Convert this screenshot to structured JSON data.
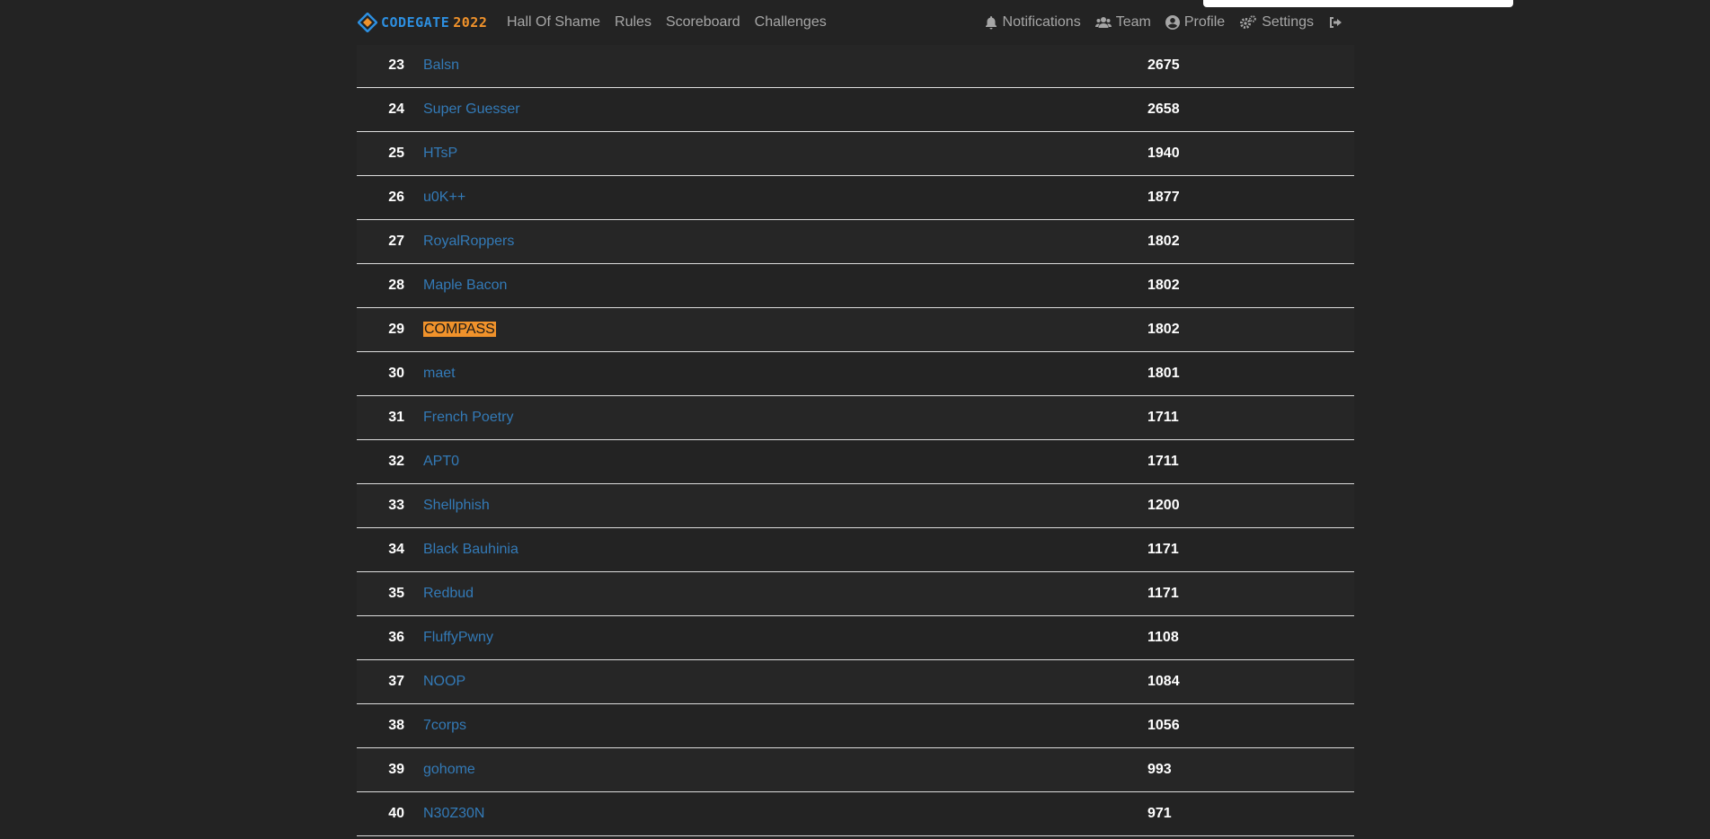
{
  "brand": {
    "part1": "CODEGATE",
    "part2": "2022"
  },
  "nav": {
    "left": [
      "Hall Of Shame",
      "Rules",
      "Scoreboard",
      "Challenges"
    ],
    "notifications": "Notifications",
    "team": "Team",
    "profile": "Profile",
    "settings": "Settings"
  },
  "colors": {
    "background": "#232323",
    "link": "#337ab7",
    "highlight": "#f0922b",
    "brand_blue": "#2d8fe0"
  },
  "rows": [
    {
      "rank": "23",
      "team": "Balsn",
      "score": "2675"
    },
    {
      "rank": "24",
      "team": "Super Guesser",
      "score": "2658"
    },
    {
      "rank": "25",
      "team": "HTsP",
      "score": "1940"
    },
    {
      "rank": "26",
      "team": "u0K++",
      "score": "1877"
    },
    {
      "rank": "27",
      "team": "RoyalRoppers",
      "score": "1802"
    },
    {
      "rank": "28",
      "team": "Maple Bacon",
      "score": "1802"
    },
    {
      "rank": "29",
      "team": "COMPASS",
      "score": "1802",
      "highlight": true
    },
    {
      "rank": "30",
      "team": "maet",
      "score": "1801"
    },
    {
      "rank": "31",
      "team": "French Poetry",
      "score": "1711"
    },
    {
      "rank": "32",
      "team": "APT0",
      "score": "1711"
    },
    {
      "rank": "33",
      "team": "Shellphish",
      "score": "1200"
    },
    {
      "rank": "34",
      "team": "Black Bauhinia",
      "score": "1171"
    },
    {
      "rank": "35",
      "team": "Redbud",
      "score": "1171"
    },
    {
      "rank": "36",
      "team": "FluffyPwny",
      "score": "1108"
    },
    {
      "rank": "37",
      "team": "NOOP",
      "score": "1084"
    },
    {
      "rank": "38",
      "team": "7corps",
      "score": "1056"
    },
    {
      "rank": "39",
      "team": "gohome",
      "score": "993"
    },
    {
      "rank": "40",
      "team": "N30Z30N",
      "score": "971"
    }
  ]
}
